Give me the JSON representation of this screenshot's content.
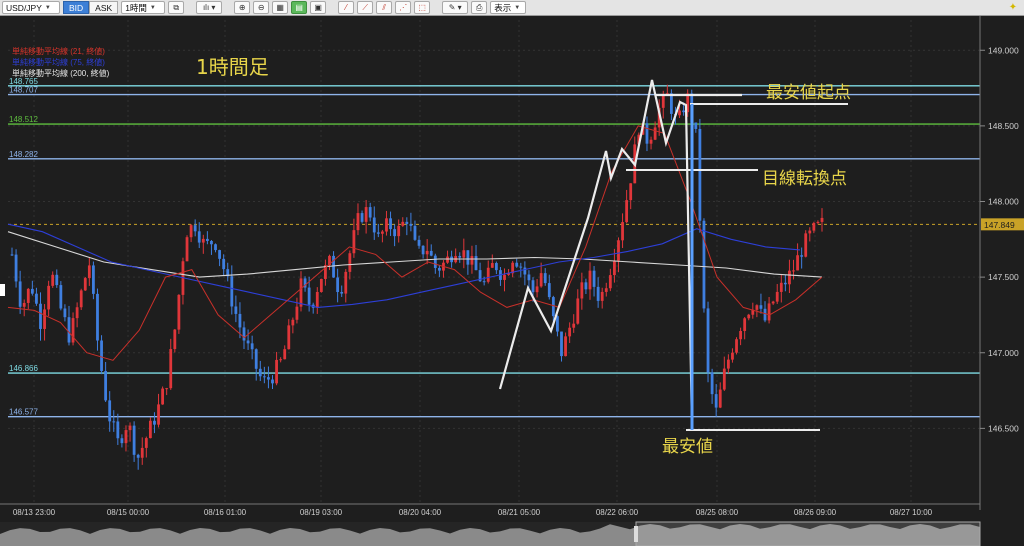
{
  "toolbar": {
    "symbol": "USD/JPY",
    "bid_label": "BID",
    "ask_label": "ASK",
    "timeframe": "1時間",
    "display_label": "表示"
  },
  "legend": [
    {
      "text": "単純移動平均線 (21, 終値)",
      "color": "#d9342b"
    },
    {
      "text": "単純移動平均線 (75, 終値)",
      "color": "#2d3fd8"
    },
    {
      "text": "単純移動平均線 (200, 終値)",
      "color": "#e8e8e8"
    }
  ],
  "annotations": {
    "timeframe_title": "1時間足",
    "low_start": "最安値起点",
    "line_switch": "目線転換点",
    "lowest": "最安値"
  },
  "chart_data": {
    "type": "candlestick",
    "pair": "USD/JPY",
    "interval": "1時間",
    "ylim": [
      146.0,
      149.2
    ],
    "y_ticks": [
      "149.000",
      "148.500",
      "148.000",
      "147.500",
      "147.000",
      "146.500"
    ],
    "x_ticks": [
      "08/13 23:00",
      "08/15 00:00",
      "08/16 01:00",
      "08/19 03:00",
      "08/20 04:00",
      "08/21 05:00",
      "08/22 06:00",
      "08/25 08:00",
      "08/26 09:00",
      "08/27 10:00"
    ],
    "current_price": "147.849",
    "horizontal_lines": [
      {
        "label": "148.765",
        "value": 148.765,
        "color": "#7fdbe4"
      },
      {
        "label": "148.707",
        "value": 148.707,
        "color": "#8fb4ea"
      },
      {
        "label": "148.512",
        "value": 148.512,
        "color": "#5fbf3f"
      },
      {
        "label": "148.282",
        "value": 148.282,
        "color": "#8fb4ea"
      },
      {
        "label": "146.866",
        "value": 146.866,
        "color": "#7fdbe4"
      },
      {
        "label": "146.577",
        "value": 146.577,
        "color": "#8fb4ea"
      }
    ],
    "close_path": [
      147.65,
      147.3,
      147.45,
      147.2,
      147.55,
      147.3,
      147.1,
      147.35,
      147.6,
      147.0,
      146.6,
      146.4,
      146.55,
      146.3,
      146.45,
      146.6,
      146.8,
      147.2,
      147.8,
      147.85,
      147.7,
      147.75,
      147.55,
      147.3,
      147.1,
      146.95,
      146.8,
      146.85,
      146.95,
      147.2,
      147.45,
      147.3,
      147.5,
      147.6,
      147.4,
      147.65,
      147.9,
      147.95,
      147.75,
      147.85,
      147.8,
      147.9,
      147.65,
      147.7,
      147.55,
      147.6,
      147.7,
      147.65,
      147.55,
      147.45,
      147.6,
      147.5,
      147.65,
      147.55,
      147.4,
      147.55,
      147.25,
      147.0,
      147.2,
      147.4,
      147.5,
      147.35,
      147.55,
      147.8,
      148.1,
      148.5,
      148.4,
      148.6,
      148.7,
      148.5,
      148.7,
      148.4,
      146.9,
      146.6,
      146.9,
      147.1,
      147.25,
      147.35,
      147.2,
      147.35,
      147.45,
      147.55,
      147.7,
      147.8,
      147.85
    ],
    "sma21": [
      147.3,
      147.28,
      147.2,
      147.0,
      146.95,
      147.15,
      147.5,
      147.55,
      147.25,
      147.1,
      147.25,
      147.4,
      147.55,
      147.7,
      147.65,
      147.5,
      147.6,
      147.55,
      147.4,
      147.3,
      147.35,
      147.3,
      147.7,
      148.2,
      148.5,
      148.45,
      148.0,
      147.5,
      147.3,
      147.25,
      147.35,
      147.5
    ],
    "sma75": [
      147.85,
      147.8,
      147.7,
      147.6,
      147.55,
      147.5,
      147.45,
      147.4,
      147.35,
      147.3,
      147.32,
      147.35,
      147.4,
      147.45,
      147.5,
      147.55,
      147.6,
      147.63,
      147.67,
      147.72,
      147.82,
      147.75,
      147.7,
      147.68
    ],
    "sma200": [
      147.8,
      147.7,
      147.6,
      147.55,
      147.5,
      147.52,
      147.55,
      147.58,
      147.6,
      147.62,
      147.62,
      147.63,
      147.62,
      147.6,
      147.58,
      147.56,
      147.52,
      147.5
    ]
  }
}
